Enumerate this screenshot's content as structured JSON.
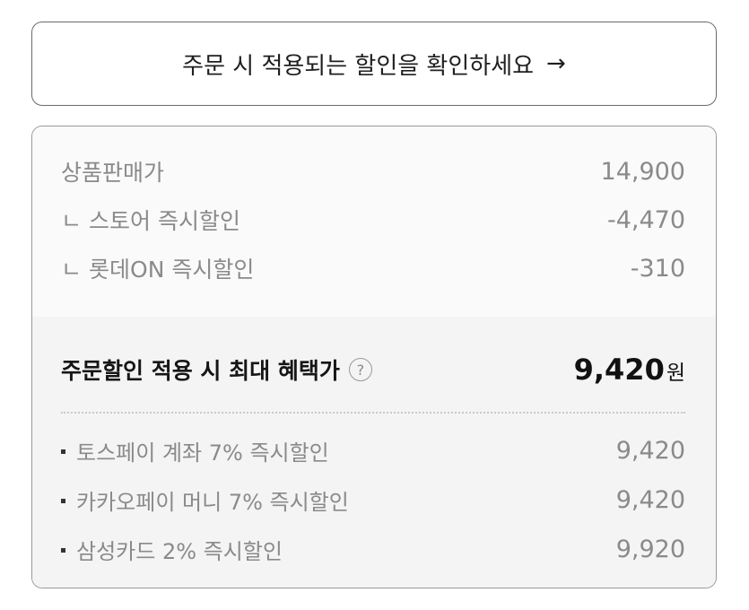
{
  "banner": {
    "text": "주문 시 적용되는 할인을 확인하세요",
    "arrow": "→"
  },
  "price_breakdown": {
    "items": [
      {
        "prefix": "",
        "label": "상품판매가",
        "value": "14,900"
      },
      {
        "prefix": "ㄴ",
        "label": "스토어 즉시할인",
        "value": "-4,470"
      },
      {
        "prefix": "ㄴ",
        "label": "롯데ON 즉시할인",
        "value": "-310"
      }
    ]
  },
  "max_benefit": {
    "label": "주문할인 적용 시 최대 혜택가",
    "help_glyph": "?",
    "value": "9,420",
    "unit": "원"
  },
  "payment_discounts": [
    {
      "label": "토스페이 계좌 7% 즉시할인",
      "value": "9,420"
    },
    {
      "label": "카카오페이 머니 7% 즉시할인",
      "value": "9,420"
    },
    {
      "label": "삼성카드 2% 즉시할인",
      "value": "9,920"
    }
  ],
  "colors": {
    "border": "#9a9a9a",
    "muted_text": "#8a8a8a",
    "strong_text": "#111111",
    "panel_bg": "#f4f4f4"
  }
}
